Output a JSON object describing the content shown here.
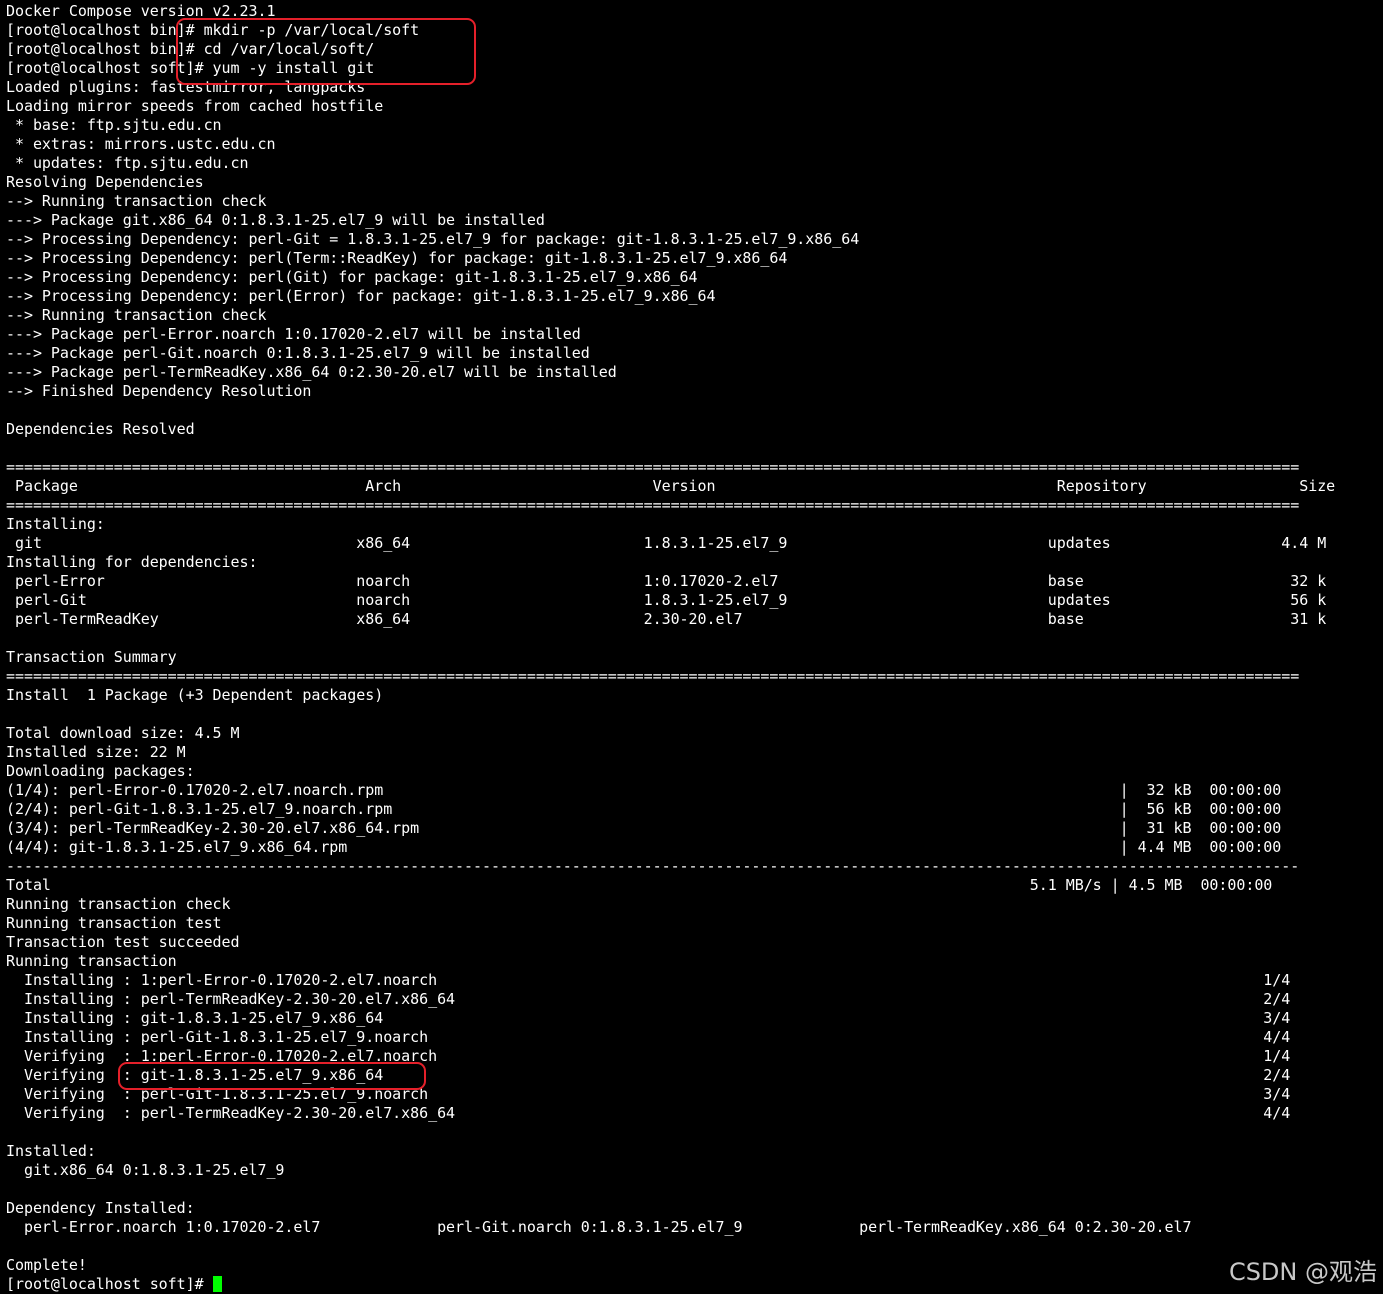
{
  "terminal": {
    "lines": [
      "Docker Compose version v2.23.1",
      "[root@localhost bin]# mkdir -p /var/local/soft",
      "[root@localhost bin]# cd /var/local/soft/",
      "[root@localhost soft]# yum -y install git",
      "Loaded plugins: fastestmirror, langpacks",
      "Loading mirror speeds from cached hostfile",
      " * base: ftp.sjtu.edu.cn",
      " * extras: mirrors.ustc.edu.cn",
      " * updates: ftp.sjtu.edu.cn",
      "Resolving Dependencies",
      "--> Running transaction check",
      "---> Package git.x86_64 0:1.8.3.1-25.el7_9 will be installed",
      "--> Processing Dependency: perl-Git = 1.8.3.1-25.el7_9 for package: git-1.8.3.1-25.el7_9.x86_64",
      "--> Processing Dependency: perl(Term::ReadKey) for package: git-1.8.3.1-25.el7_9.x86_64",
      "--> Processing Dependency: perl(Git) for package: git-1.8.3.1-25.el7_9.x86_64",
      "--> Processing Dependency: perl(Error) for package: git-1.8.3.1-25.el7_9.x86_64",
      "--> Running transaction check",
      "---> Package perl-Error.noarch 1:0.17020-2.el7 will be installed",
      "---> Package perl-Git.noarch 0:1.8.3.1-25.el7_9 will be installed",
      "---> Package perl-TermReadKey.x86_64 0:2.30-20.el7 will be installed",
      "--> Finished Dependency Resolution",
      "",
      "Dependencies Resolved",
      "",
      "================================================================================================================================================",
      " Package                                Arch                            Version                                      Repository                 Size",
      "================================================================================================================================================",
      "Installing:",
      " git                                   x86_64                          1.8.3.1-25.el7_9                             updates                   4.4 M",
      "Installing for dependencies:",
      " perl-Error                            noarch                          1:0.17020-2.el7                              base                       32 k",
      " perl-Git                              noarch                          1.8.3.1-25.el7_9                             updates                    56 k",
      " perl-TermReadKey                      x86_64                          2.30-20.el7                                  base                       31 k",
      "",
      "Transaction Summary",
      "================================================================================================================================================",
      "Install  1 Package (+3 Dependent packages)",
      "",
      "Total download size: 4.5 M",
      "Installed size: 22 M",
      "Downloading packages:",
      "(1/4): perl-Error-0.17020-2.el7.noarch.rpm                                                                                  |  32 kB  00:00:00",
      "(2/4): perl-Git-1.8.3.1-25.el7_9.noarch.rpm                                                                                 |  56 kB  00:00:00",
      "(3/4): perl-TermReadKey-2.30-20.el7.x86_64.rpm                                                                              |  31 kB  00:00:00",
      "(4/4): git-1.8.3.1-25.el7_9.x86_64.rpm                                                                                      | 4.4 MB  00:00:00",
      "------------------------------------------------------------------------------------------------------------------------------------------------",
      "Total                                                                                                             5.1 MB/s | 4.5 MB  00:00:00",
      "Running transaction check",
      "Running transaction test",
      "Transaction test succeeded",
      "Running transaction",
      "  Installing : 1:perl-Error-0.17020-2.el7.noarch                                                                                            1/4",
      "  Installing : perl-TermReadKey-2.30-20.el7.x86_64                                                                                          2/4",
      "  Installing : git-1.8.3.1-25.el7_9.x86_64                                                                                                  3/4",
      "  Installing : perl-Git-1.8.3.1-25.el7_9.noarch                                                                                             4/4",
      "  Verifying  : 1:perl-Error-0.17020-2.el7.noarch                                                                                            1/4",
      "  Verifying  : git-1.8.3.1-25.el7_9.x86_64                                                                                                  2/4",
      "  Verifying  : perl-Git-1.8.3.1-25.el7_9.noarch                                                                                             3/4",
      "  Verifying  : perl-TermReadKey-2.30-20.el7.x86_64                                                                                          4/4",
      "",
      "Installed:",
      "  git.x86_64 0:1.8.3.1-25.el7_9",
      "",
      "Dependency Installed:",
      "  perl-Error.noarch 1:0.17020-2.el7             perl-Git.noarch 0:1.8.3.1-25.el7_9             perl-TermReadKey.x86_64 0:2.30-20.el7",
      "",
      "Complete!"
    ],
    "prompt": "[root@localhost soft]# "
  },
  "watermark": "CSDN @观浩",
  "colors": {
    "background": "#000000",
    "text": "#ffffff",
    "cursor": "#00ff00",
    "highlight": "#e5202a"
  }
}
